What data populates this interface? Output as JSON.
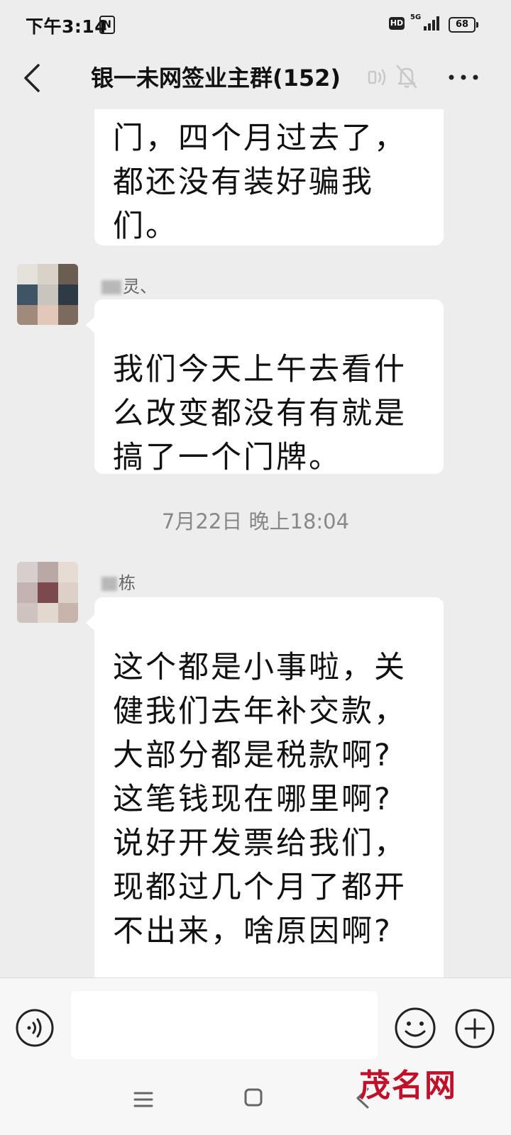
{
  "status_bar": {
    "time": "下午3:14",
    "nfc_icon": "nfc-icon",
    "hd_label": "HD",
    "network_label": "5G",
    "battery_level": "68"
  },
  "header": {
    "title": "银一未网签业主群(152)",
    "icons": [
      "back-icon",
      "voice-mode-icon",
      "mute-bell-icon",
      "more-icon"
    ]
  },
  "messages": [
    {
      "sender": "",
      "text": "门，四个月过去了，\n都还没有装好骗我\n们。"
    },
    {
      "sender": "灵、",
      "text": "我们今天上午去看什\n么改变都没有有就是\n搞了一个门牌。"
    },
    {
      "sender": "栋",
      "text": "这个都是小事啦，关\n健我们去年补交款，\n大部分都是税款啊?\n这笔钱现在哪里啊?\n说好开发票给我们，\n现都过几个月了都开\n不出来，啥原因啊?"
    }
  ],
  "timestamp": "7月22日 晚上18:04",
  "input_bar": {
    "placeholder": "",
    "icons": [
      "voice-input-icon",
      "emoji-icon",
      "plus-icon"
    ]
  },
  "watermark": "茂名网",
  "colors": {
    "background": "#ededed",
    "bubble": "#ffffff",
    "watermark": "#c0102a"
  }
}
